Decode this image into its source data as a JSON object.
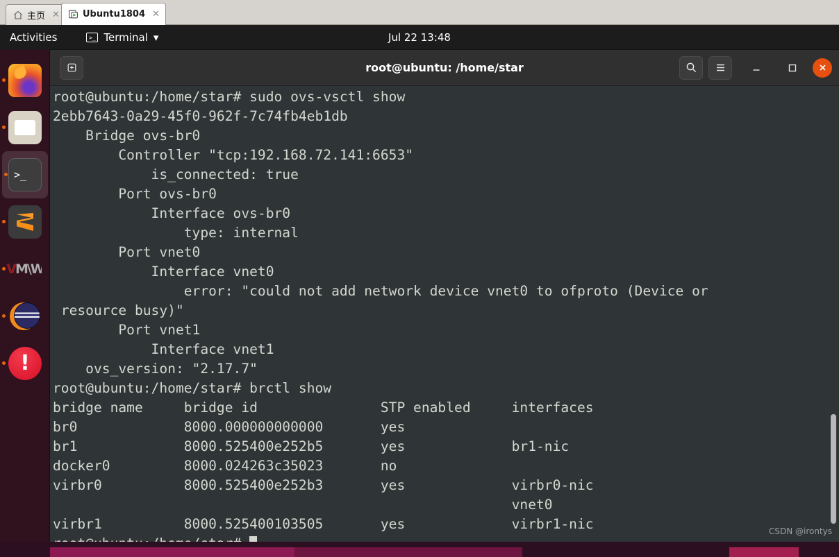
{
  "vmware_tabs": [
    {
      "label": "主页",
      "icon": "home-icon",
      "close": "✕",
      "active": false
    },
    {
      "label": "Ubuntu1804",
      "icon": "vm-icon",
      "close": "✕",
      "active": true
    }
  ],
  "topbar": {
    "activities": "Activities",
    "app_menu": "Terminal",
    "app_menu_icon": "terminal-icon",
    "app_menu_caret": "▾",
    "clock": "Jul 22  13:48"
  },
  "dock": {
    "items": [
      {
        "name": "firefox",
        "label": "Firefox",
        "running": true
      },
      {
        "name": "files",
        "label": "Files",
        "running": true
      },
      {
        "name": "terminal",
        "label": "Terminal",
        "running": true,
        "focused": true
      },
      {
        "name": "sublime-text",
        "label": "Sublime Text",
        "running": true
      },
      {
        "name": "vmware",
        "label": "VMware",
        "running": true,
        "glyph_red": "V",
        "glyph_rest": "M\\W"
      },
      {
        "name": "eclipse",
        "label": "Eclipse",
        "running": true
      },
      {
        "name": "alert",
        "label": "System Alert",
        "running": true,
        "glyph": "!"
      }
    ]
  },
  "window": {
    "title": "root@ubuntu: /home/star",
    "new_tab_icon": "new-tab-icon",
    "search_icon": "search-icon",
    "menu_icon": "hamburger-menu-icon",
    "minimize": "_",
    "maximize": "□",
    "close": "✕"
  },
  "terminal": {
    "prompt": "root@ubuntu:/home/star#",
    "watermark": "CSDN @irontys",
    "lines": [
      "root@ubuntu:/home/star# sudo ovs-vsctl show",
      "2ebb7643-0a29-45f0-962f-7c74fb4eb1db",
      "    Bridge ovs-br0",
      "        Controller \"tcp:192.168.72.141:6653\"",
      "            is_connected: true",
      "        Port ovs-br0",
      "            Interface ovs-br0",
      "                type: internal",
      "        Port vnet0",
      "            Interface vnet0",
      "                error: \"could not add network device vnet0 to ofproto (Device or",
      " resource busy)\"",
      "        Port vnet1",
      "            Interface vnet1",
      "    ovs_version: \"2.17.7\"",
      "root@ubuntu:/home/star# brctl show",
      "bridge name     bridge id               STP enabled     interfaces",
      "br0             8000.000000000000       yes",
      "br1             8000.525400e252b5       yes             br1-nic",
      "docker0         8000.024263c35023       no",
      "virbr0          8000.525400e252b3       yes             virbr0-nic",
      "                                                        vnet0",
      "virbr1          8000.525400103505       yes             virbr1-nic"
    ],
    "ovs": {
      "uuid": "2ebb7643-0a29-45f0-962f-7c74fb4eb1db",
      "bridge": "ovs-br0",
      "controller": "tcp:192.168.72.141:6653",
      "is_connected": "true",
      "ovs_version": "2.17.7",
      "ports": [
        "ovs-br0",
        "vnet0",
        "vnet1"
      ],
      "vnet0_error": "could not add network device vnet0 to ofproto (Device or resource busy)"
    },
    "brctl_table": {
      "headers": [
        "bridge name",
        "bridge id",
        "STP enabled",
        "interfaces"
      ],
      "rows": [
        {
          "bridge_name": "br0",
          "bridge_id": "8000.000000000000",
          "stp_enabled": "yes",
          "interfaces": []
        },
        {
          "bridge_name": "br1",
          "bridge_id": "8000.525400e252b5",
          "stp_enabled": "yes",
          "interfaces": [
            "br1-nic"
          ]
        },
        {
          "bridge_name": "docker0",
          "bridge_id": "8000.024263c35023",
          "stp_enabled": "no",
          "interfaces": []
        },
        {
          "bridge_name": "virbr0",
          "bridge_id": "8000.525400e252b3",
          "stp_enabled": "yes",
          "interfaces": [
            "virbr0-nic",
            "vnet0"
          ]
        },
        {
          "bridge_name": "virbr1",
          "bridge_id": "8000.525400103505",
          "stp_enabled": "yes",
          "interfaces": [
            "virbr1-nic"
          ]
        }
      ]
    }
  },
  "colors": {
    "terminal_bg": "#2f3436",
    "terminal_fg": "#d3d7cf",
    "topbar_bg": "#1c1c1c",
    "dock_bg": "#32101e",
    "accent_orange": "#e8500f",
    "titlebar_bg": "#303030"
  }
}
